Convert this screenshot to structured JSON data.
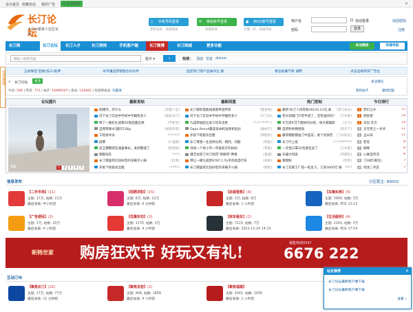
{
  "topbar": {
    "home": "设为首页",
    "fav": "收藏本站",
    "ads": "我的广告",
    "follow": "关注微信"
  },
  "logo": {
    "title": "长汀论坛",
    "subtitle": "大汀州客家人社区论坛"
  },
  "login_buttons": [
    {
      "label": "手机号码登录",
      "tip": "手机号码，快速登录",
      "color": "#2a9fd6"
    },
    {
      "label": "微信账号登录",
      "tip": "快捷登录",
      "color": "#3bb24a"
    },
    {
      "label": "用QQ账号登录",
      "tip": "只需一步，快速开始",
      "color": "#2a9fd6"
    }
  ],
  "login": {
    "user_label": "用户名",
    "pass_label": "密码",
    "auto": "自动登录",
    "remember": "找回密码",
    "register": "注册",
    "login": "登录"
  },
  "nav": [
    "长汀网",
    "长汀论坛",
    "长汀人才",
    "长汀房网",
    "手机客户端",
    "长汀微博",
    "长汀网城",
    "更多功能"
  ],
  "nav_right": {
    "wechat": "关注微信",
    "quick": "快捷导航"
  },
  "search": {
    "placeholder": "请输入搜索内容",
    "scope": "帖子",
    "hot_label": "热搜：",
    "hot": [
      "活动",
      "交友",
      "discuz"
    ]
  },
  "side_tab": "在线客服",
  "adbar": [
    "五福珠宝-回收/加工/抵押",
    "寻求懂运营管理合作伙伴",
    "监控刻门禁产品做作出 美",
    "香石板餐厅新 诚聘",
    "点击自助购买广告位"
  ],
  "breadcrumb": {
    "name": "长汀论坛",
    "follow": "关注"
  },
  "stats": {
    "today_label": "今日",
    "today": "546",
    "yesterday_label": "昨日",
    "yesterday": "772",
    "posts_label": "帖子",
    "posts": "10496547",
    "members_label": "会员",
    "members": "134492",
    "new_label": "欢迎新会员",
    "newest": "刘嘉逊",
    "my_posts": "我的帖子",
    "newest_reply": "最新回复",
    "link": "关注微信"
  },
  "columns": [
    "论坛图片",
    "最新发帖",
    "最新回复",
    "热门发帖",
    "今日排行"
  ],
  "gallery": {
    "caption": "青影",
    "pages": [
      "1",
      "2",
      "3",
      "4",
      "5"
    ]
  },
  "new_posts": [
    {
      "t": "刚爆炸，炸什么",
      "m": "[笑看人生]"
    },
    {
      "t": "问下长汀实验中学初中学籍有多少",
      "m": "[想去长汀]"
    },
    {
      "t": "降了一路杠扎进来50张后面出保",
      "m": "[不断流]"
    },
    {
      "t": "自用苹果4G国行128g",
      "m": "[褪色风景]"
    },
    {
      "t": "工程技术员",
      "m": "[Sxxxx]"
    },
    {
      "t": "招聘",
      "m": "[小强嘉]"
    },
    {
      "t": "反正都晒得在湖里事长，发到晒墙了",
      "m": "[哈哈哈]"
    },
    {
      "t": "钢筋钻孔",
      "m": "[sss]"
    },
    {
      "t": "长汀哪里有比较好吃的羊蝎子火锅",
      "m": "[红英]"
    },
    {
      "t": "东街下街套房出租",
      "m": "[1995]"
    }
  ],
  "new_replies": [
    {
      "t": "长汀钢架电瓶线发钢带促所有",
      "m": "[鲁伯顿]"
    },
    {
      "t": "问下长汀实验中学初中学籍有多少",
      "m": "[大汀州]"
    },
    {
      "t": "九成新福田五星三轮车出售",
      "m": "[13178167]"
    },
    {
      "t": "Oppo Reno4最美安卓机准新机低价",
      "m": "[微林万]"
    },
    {
      "t": "东街下街套房出租",
      "m": "[邱胜利]"
    },
    {
      "t": "长汀港澳一生涯秒达到，相同，问题",
      "m": "[明星]"
    },
    {
      "t": "寻找一个男小学一年级孩子的妈妈",
      "m": "[帝国]"
    },
    {
      "t": "谦洁古韵汀州汀经历\"单眼风\"青峨",
      "m": "[金城]"
    },
    {
      "t": "特让一辆九成新9787 1.5L手风高自行车",
      "m": "[商来]"
    },
    {
      "t": "长汀哪里有比较好吃的羊蝎子火锅",
      "m": "[明星]"
    }
  ],
  "hot_posts": [
    {
      "t": "最新!长汀人均存款39243.21元,收",
      "m": "[第汀县长]"
    },
    {
      "t": "苍头到城门只有半道了，还有强的吗？",
      "m": "[汀州客]"
    },
    {
      "t": "#沉渣#沉下面你的分别，请大家踊跃",
      "m": "[大汀]"
    },
    {
      "t": "自捞秒杀教授窗",
      "m": "[寄天下]"
    },
    {
      "t": "最新都能都由汀中蓝说，发个说资历",
      "m": "[汀州风云]"
    },
    {
      "t": "长汀叶上班",
      "m": "[15200004]"
    },
    {
      "t": "一次性口罩20包便宜卖了",
      "m": "[汀州客]"
    },
    {
      "t": "乐器大甩卖",
      "m": "[何瑟拉]"
    },
    {
      "t": "塞相粉",
      "m": "[吹吹]"
    },
    {
      "t": "长汀这家工厂招一批女工，工资3000元 联",
      "m": "[hh]"
    }
  ],
  "rank": [
    {
      "t": "梦幻之乡",
      "n": "27"
    },
    {
      "t": "明星者",
      "n": "14"
    },
    {
      "t": "日出 东方",
      "n": "14"
    },
    {
      "t": "天无有土一点点",
      "n": "12"
    },
    {
      "t": "孟山白",
      "n": "11"
    },
    {
      "t": "若名",
      "n": "8"
    },
    {
      "t": "随晔",
      "n": "8"
    },
    {
      "t": "心静自然凉",
      "n": "8"
    },
    {
      "t": "汀州府(重信)",
      "n": "7"
    },
    {
      "t": "闲龙二手店",
      "n": "7"
    }
  ],
  "info_section": {
    "title": "信息发布",
    "mod": "分区版主: B9002"
  },
  "forums": [
    {
      "name": "【二手市场】",
      "count": "(11)",
      "l1": "主题: 17万, 帖数: 21万",
      "l2": "最后发表: 半小时前",
      "color": "#e23a3a"
    },
    {
      "name": "【招聘求职】",
      "count": "(15)",
      "l1": "主题: 6万, 帖数: 12万",
      "l2": "最后发表: 6 分钟前",
      "color": "#d62e6b"
    },
    {
      "name": "【房屋租售】",
      "count": "(9)",
      "l1": "主题: 1万, 帖数: 9万",
      "l2": "最后发表: 1 小时前",
      "color": "#c62828"
    },
    {
      "name": "【车辆买卖】",
      "count": "(5)",
      "l1": "主题: 3900, 帖数: 3万",
      "l2": "最后发表: 昨天 22:12",
      "color": "#1565c0"
    },
    {
      "name": "【广告便民】",
      "count": "(2)",
      "l1": "主题: 1万, 帖数: 10万",
      "l2": "最后发表: 4 小时前",
      "color": "#f39c12"
    },
    {
      "name": "【优惠折扣】",
      "count": "(2)",
      "l1": "主题: 1170, 帖数: 2万",
      "l2": "最后发表: 4 小时前",
      "color": "#e53935"
    },
    {
      "name": "【拼车租车】",
      "count": "(2)",
      "l1": "主题: 7223, 帖数: 7万",
      "l2": "最后发表: 2021-11-16 14:13",
      "color": "#263238"
    },
    {
      "name": "【生活服务】",
      "count": "(4)",
      "l1": "主题: 2163, 帖数: 3万",
      "l2": "最后发表: 昨天 17:54",
      "color": "#1e88e5"
    }
  ],
  "banner": {
    "brand": "新韩世家",
    "slogan": "购房狂欢节 好玩又有礼!",
    "phone_label": "销售热线0597",
    "phone": "6676 222"
  },
  "interact_section": {
    "title": "互动汀州"
  },
  "interact": [
    {
      "name": "【聚焦长汀】",
      "count": "(22)",
      "l1": "主题: 17万, 帖数: 77万",
      "l2": "最后发表: 11 分钟前",
      "color": "#0d47a1"
    },
    {
      "name": "【聚焦龙岩】",
      "count": "(2)",
      "l1": "主题: 906, 帖数: 1809",
      "l2": "最后发表: 4 小时前",
      "color": "#c62828"
    },
    {
      "name": "【聚焦福建】",
      "count": "",
      "l1": "主题: 1041, 帖数: 1936",
      "l2": "最后发表: 1 小时前",
      "color": "#b71c1c"
    }
  ],
  "popup": {
    "title": "站长推荐",
    "t1": "长汀论坛最新客户端下载",
    "t2": "长汀论坛最新客户端下载",
    "more": "查看 »"
  }
}
